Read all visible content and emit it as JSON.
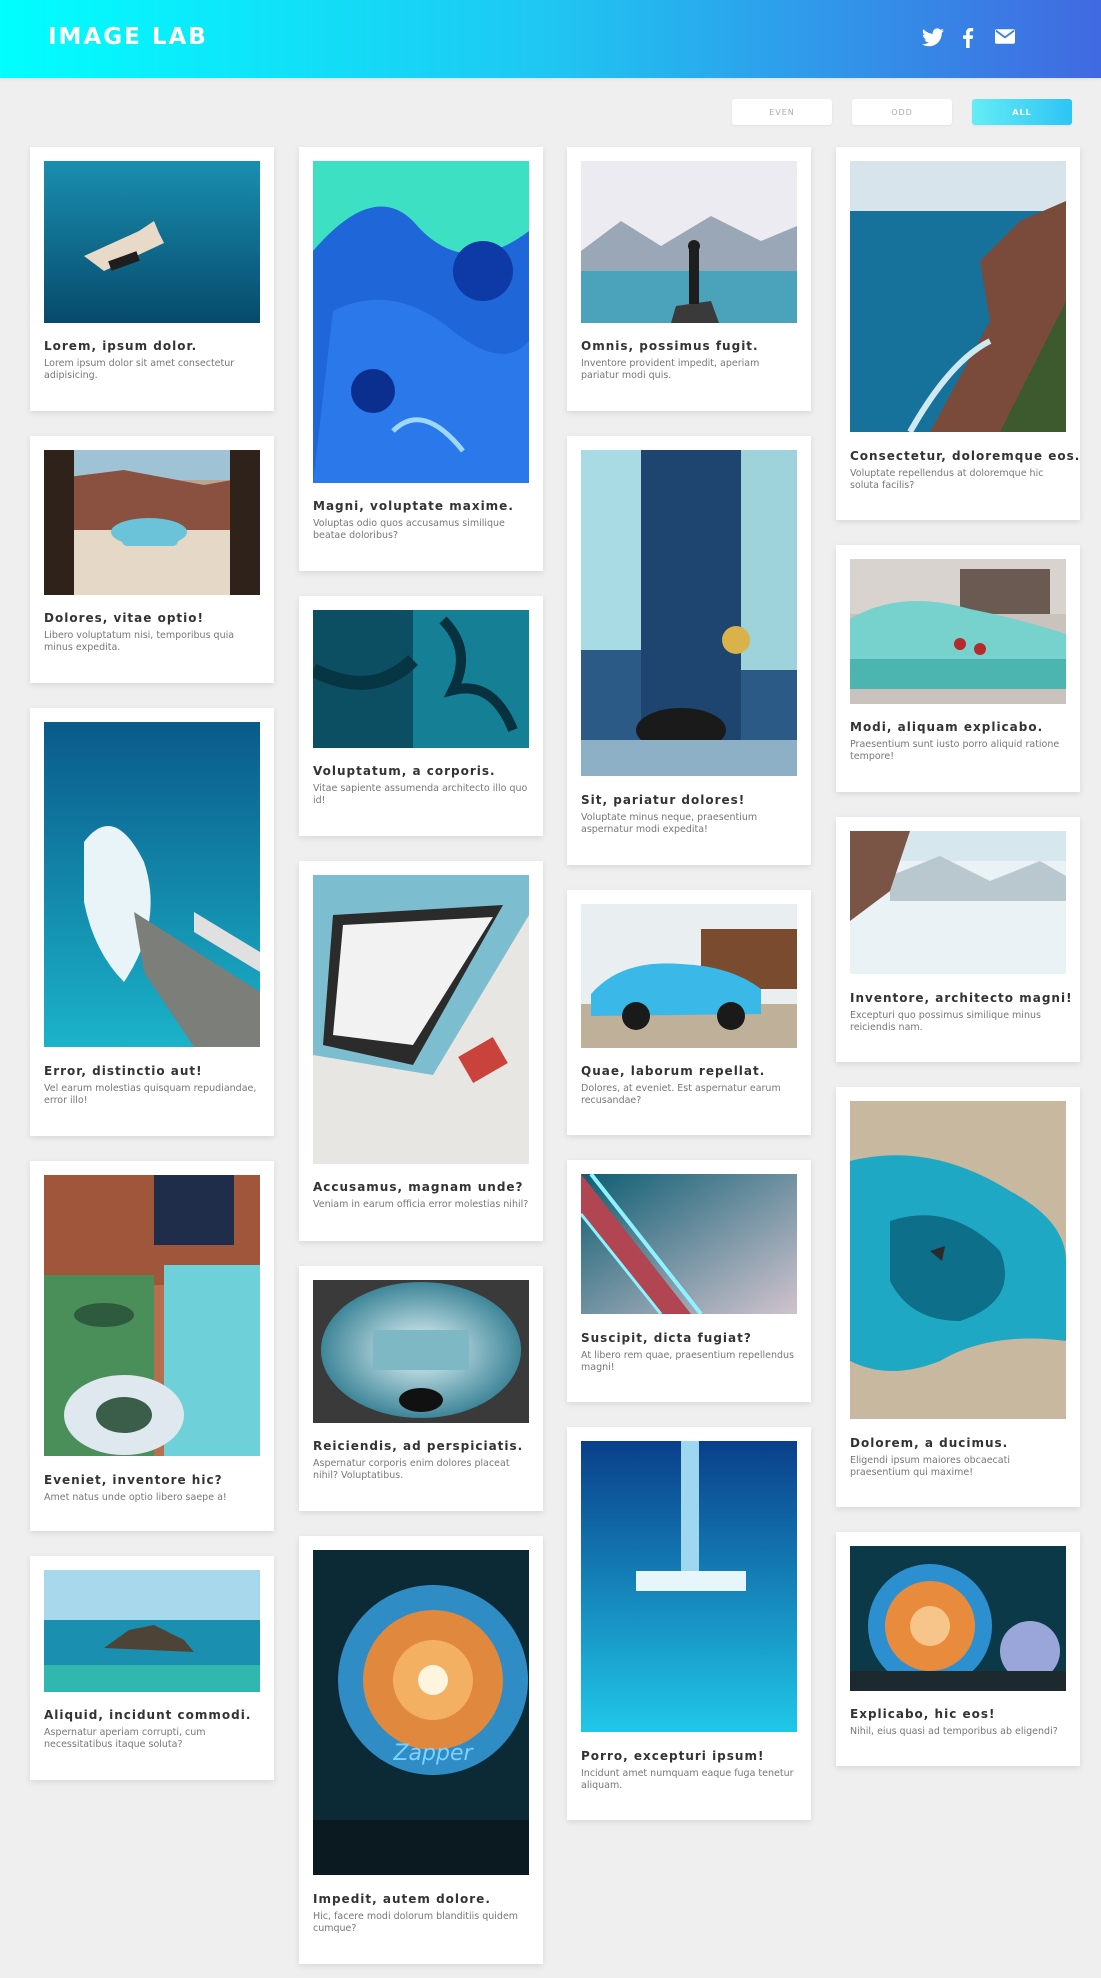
{
  "header": {
    "logo": "IMAGE LAB",
    "social_icons": [
      "twitter-icon",
      "facebook-icon",
      "mail-icon"
    ]
  },
  "filters": {
    "even": "EVEN",
    "odd": "ODD",
    "all": "ALL",
    "active": "ALL"
  },
  "cards": [
    {
      "title": "Lorem, ipsum dolor.",
      "desc": "Lorem ipsum dolor sit amet consectetur adipisicing."
    },
    {
      "title": "Dolores, vitae optio!",
      "desc": "Libero voluptatum nisi, temporibus quia minus expedita."
    },
    {
      "title": "Error, distinctio aut!",
      "desc": "Vel earum molestias quisquam repudiandae, error illo!"
    },
    {
      "title": "Eveniet, inventore hic?",
      "desc": "Amet natus unde optio libero saepe a!"
    },
    {
      "title": "Aliquid, incidunt commodi.",
      "desc": "Aspernatur aperiam corrupti, cum necessitatibus itaque soluta?"
    },
    {
      "title": "Magni, voluptate maxime.",
      "desc": "Voluptas odio quos accusamus similique beatae doloribus?"
    },
    {
      "title": "Voluptatum, a corporis.",
      "desc": "Vitae sapiente assumenda architecto illo quo id!"
    },
    {
      "title": "Accusamus, magnam unde?",
      "desc": "Veniam in earum officia error molestias nihil?"
    },
    {
      "title": "Reiciendis, ad perspiciatis.",
      "desc": "Aspernatur corporis enim dolores placeat nihil? Voluptatibus."
    },
    {
      "title": "Impedit, autem dolore.",
      "desc": "Hic, facere modi dolorum blanditiis quidem cumque?"
    },
    {
      "title": "Omnis, possimus fugit.",
      "desc": "Inventore provident impedit, aperiam pariatur modi quis."
    },
    {
      "title": "Sit, pariatur dolores!",
      "desc": "Voluptate minus neque, praesentium aspernatur modi expedita!"
    },
    {
      "title": "Quae, laborum repellat.",
      "desc": "Dolores, at eveniet. Est aspernatur earum recusandae?"
    },
    {
      "title": "Suscipit, dicta fugiat?",
      "desc": "At libero rem quae, praesentium repellendus magni!"
    },
    {
      "title": "Porro, excepturi ipsum!",
      "desc": "Incidunt amet numquam eaque fuga tenetur aliquam."
    },
    {
      "title": "Consectetur, doloremque eos.",
      "desc": "Voluptate repellendus at doloremque hic soluta facilis?"
    },
    {
      "title": "Modi, aliquam explicabo.",
      "desc": "Praesentium sunt iusto porro aliquid ratione tempore!"
    },
    {
      "title": "Inventore, architecto magni!",
      "desc": "Excepturi quo possimus similique minus reiciendis nam."
    },
    {
      "title": "Dolorem, a ducimus.",
      "desc": "Eligendi ipsum maiores obcaecati praesentium qui maxime!"
    },
    {
      "title": "Explicabo, hic eos!",
      "desc": "Nihil, eius quasi ad temporibus ab eligendi?"
    }
  ]
}
